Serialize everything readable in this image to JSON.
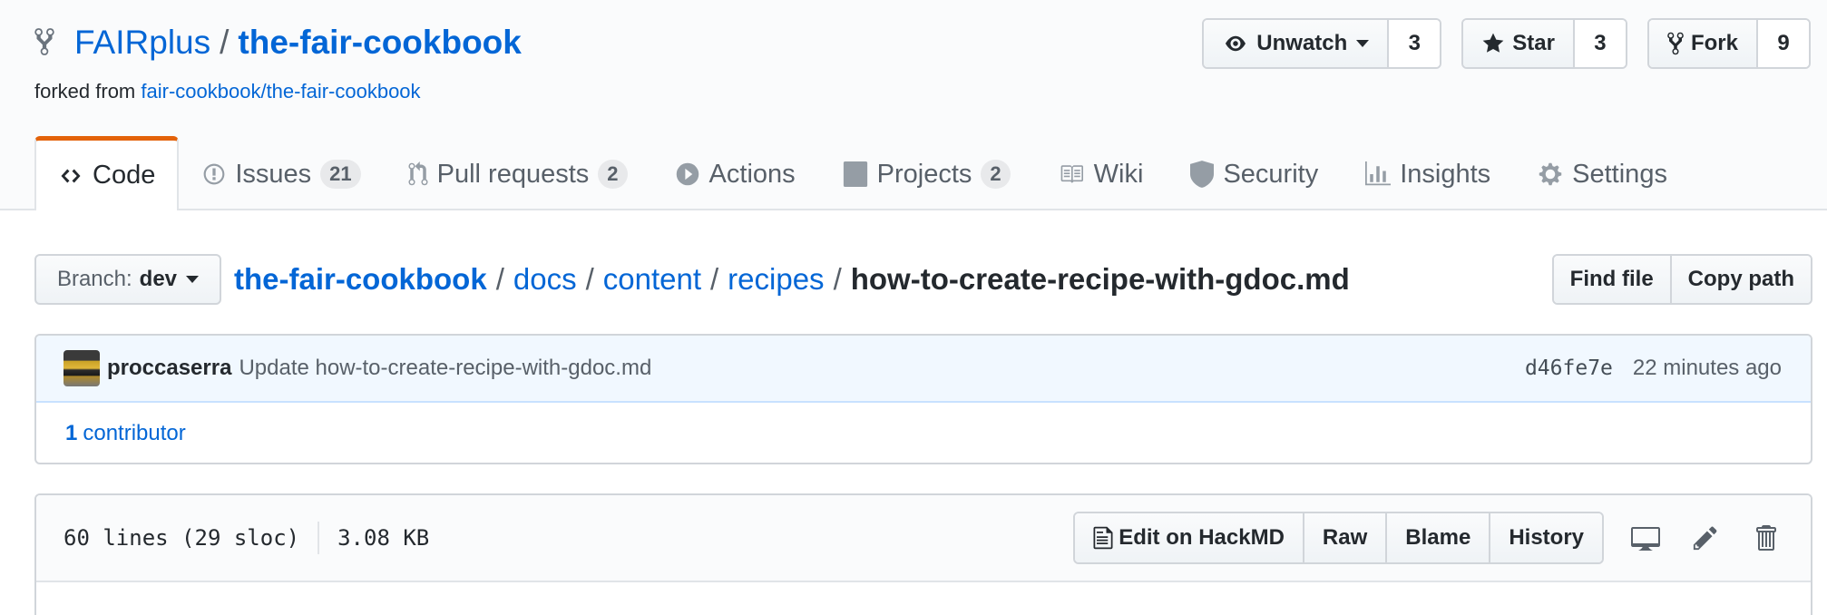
{
  "repo": {
    "owner": "FAIRplus",
    "separator": "/",
    "name": "the-fair-cookbook",
    "forked_from_prefix": "forked from",
    "forked_from_link": "fair-cookbook/the-fair-cookbook"
  },
  "actions": {
    "watch_label": "Unwatch",
    "watch_count": "3",
    "star_label": "Star",
    "star_count": "3",
    "fork_label": "Fork",
    "fork_count": "9"
  },
  "nav": {
    "tabs": [
      {
        "label": "Code",
        "counter": null,
        "selected": true
      },
      {
        "label": "Issues",
        "counter": "21"
      },
      {
        "label": "Pull requests",
        "counter": "2"
      },
      {
        "label": "Actions",
        "counter": null
      },
      {
        "label": "Projects",
        "counter": "2"
      },
      {
        "label": "Wiki",
        "counter": null
      },
      {
        "label": "Security",
        "counter": null
      },
      {
        "label": "Insights",
        "counter": null
      },
      {
        "label": "Settings",
        "counter": null
      }
    ]
  },
  "branch": {
    "prefix": "Branch:",
    "name": "dev"
  },
  "breadcrumb": {
    "items": [
      "the-fair-cookbook",
      "docs",
      "content",
      "recipes"
    ],
    "separator": "/",
    "final": "how-to-create-recipe-with-gdoc.md"
  },
  "file_nav": {
    "find_file": "Find file",
    "copy_path": "Copy path"
  },
  "commit": {
    "author": "proccaserra",
    "message": "Update how-to-create-recipe-with-gdoc.md",
    "sha": "d46fe7e",
    "age": "22 minutes ago",
    "contributors_count": "1",
    "contributors_label": "contributor"
  },
  "file": {
    "lines_info": "60 lines (29 sloc)",
    "size": "3.08 KB",
    "edit_hackmd": "Edit on HackMD",
    "raw": "Raw",
    "blame": "Blame",
    "history": "History"
  },
  "colors": {
    "link": "#0366d6",
    "selected_tab_accent": "#e36209",
    "commit_bg": "#f1f8ff"
  }
}
